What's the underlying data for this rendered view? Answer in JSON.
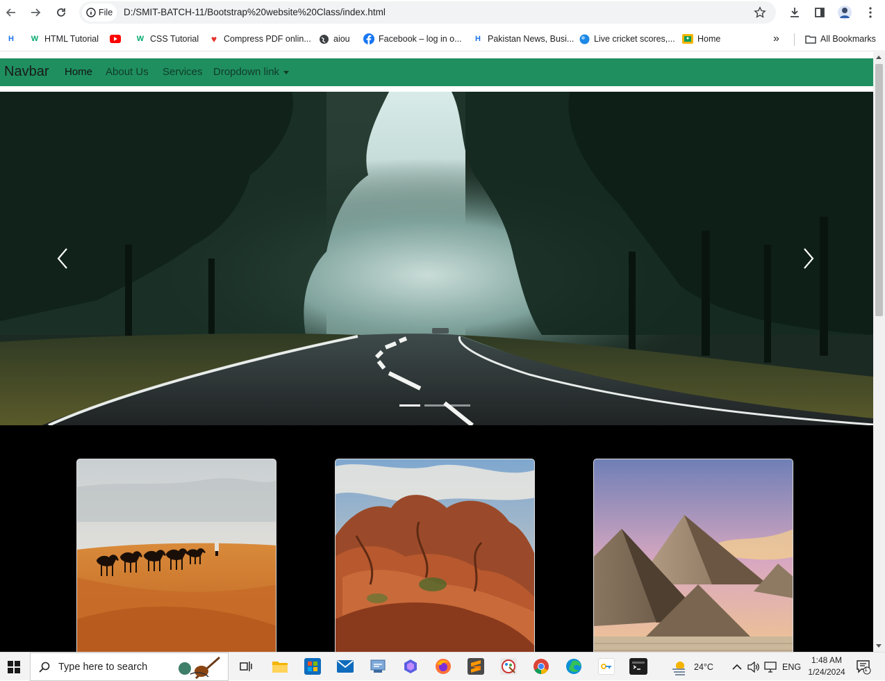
{
  "browser": {
    "url": "D:/SMIT-BATCH-11/Bootstrap%20website%20Class/index.html",
    "scheme_label": "File",
    "bookmarks": [
      {
        "label": "",
        "icon": "h-icon",
        "color": "#1a73e8"
      },
      {
        "label": "HTML Tutorial",
        "icon": "w3schools-icon",
        "color": "#04aa6d"
      },
      {
        "label": "",
        "icon": "youtube-icon",
        "color": "#ff0000"
      },
      {
        "label": "CSS Tutorial",
        "icon": "w3schools-icon",
        "color": "#04aa6d"
      },
      {
        "label": "Compress PDF onlin...",
        "icon": "heart-icon",
        "color": "#e5322d"
      },
      {
        "label": "aiou",
        "icon": "globe-icon",
        "color": "#3c4043"
      },
      {
        "label": "Facebook – log in o...",
        "icon": "facebook-icon",
        "color": "#1877f2"
      },
      {
        "label": "Pakistan News, Busi...",
        "icon": "h-icon",
        "color": "#1a73e8"
      },
      {
        "label": "Live cricket scores,...",
        "icon": "cricket-icon",
        "color": "#1e88e5"
      },
      {
        "label": "Home",
        "icon": "classroom-icon",
        "color": "#f4b400"
      }
    ],
    "all_bookmarks": "All Bookmarks",
    "overflow": "»"
  },
  "page": {
    "brand": "Navbar",
    "nav": [
      "Home",
      "About Us",
      "Services",
      "Dropdown link"
    ],
    "navbar_color": "#1f8f5f",
    "carousel": {
      "slides": 3,
      "active_index": 0
    },
    "cards": [
      {
        "image": "desert-camels"
      },
      {
        "image": "red-rocks"
      },
      {
        "image": "pyramids"
      }
    ]
  },
  "taskbar": {
    "search_placeholder": "Type here to search",
    "weather": "24°C",
    "language": "ENG",
    "time": "1:48 AM",
    "date": "1/24/2024",
    "notification_count": "1"
  }
}
